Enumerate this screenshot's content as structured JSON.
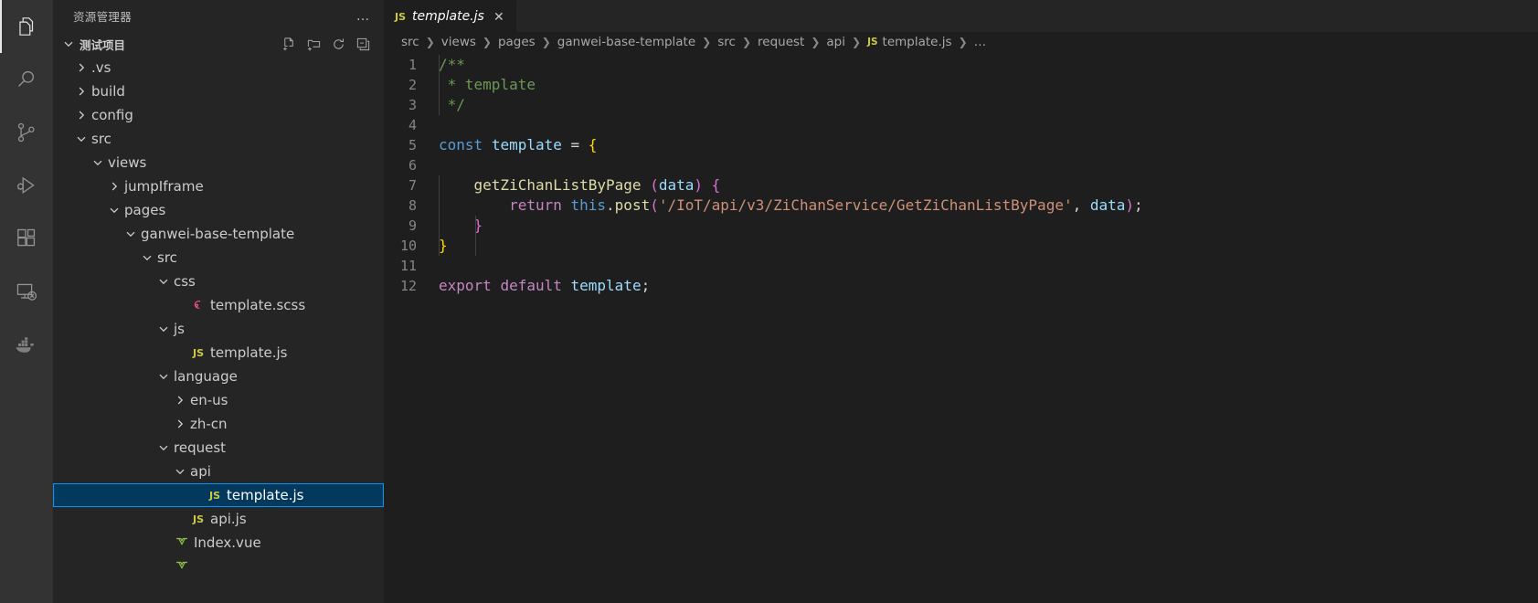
{
  "activity_bar": {
    "items": [
      {
        "name": "explorer",
        "icon": "files-icon",
        "active": true
      },
      {
        "name": "search",
        "icon": "search-icon",
        "active": false
      },
      {
        "name": "source-control",
        "icon": "source-control-icon",
        "active": false
      },
      {
        "name": "run-and-debug",
        "icon": "run-debug-icon",
        "active": false
      },
      {
        "name": "extensions",
        "icon": "extensions-icon",
        "active": false
      },
      {
        "name": "remote-explorer",
        "icon": "remote-explorer-icon",
        "active": false
      },
      {
        "name": "docker",
        "icon": "docker-icon",
        "active": false
      }
    ]
  },
  "sidebar": {
    "title": "资源管理器",
    "more_actions_label": "…",
    "section": {
      "name": "测试项目",
      "expanded": true,
      "actions": [
        {
          "name": "new-file",
          "icon": "new-file-icon"
        },
        {
          "name": "new-folder",
          "icon": "new-folder-icon"
        },
        {
          "name": "refresh",
          "icon": "refresh-icon"
        },
        {
          "name": "collapse-all",
          "icon": "collapse-all-icon"
        }
      ]
    },
    "tree": [
      {
        "label": ".vs",
        "depth": 1,
        "type": "folder",
        "state": "collapsed",
        "selected": false
      },
      {
        "label": "build",
        "depth": 1,
        "type": "folder",
        "state": "collapsed",
        "selected": false
      },
      {
        "label": "config",
        "depth": 1,
        "type": "folder",
        "state": "collapsed",
        "selected": false
      },
      {
        "label": "src",
        "depth": 1,
        "type": "folder",
        "state": "expanded",
        "selected": false
      },
      {
        "label": "views",
        "depth": 2,
        "type": "folder",
        "state": "expanded",
        "selected": false
      },
      {
        "label": "jumpIframe",
        "depth": 3,
        "type": "folder",
        "state": "collapsed",
        "selected": false
      },
      {
        "label": "pages",
        "depth": 3,
        "type": "folder",
        "state": "expanded",
        "selected": false
      },
      {
        "label": "ganwei-base-template",
        "depth": 4,
        "type": "folder",
        "state": "expanded",
        "selected": false
      },
      {
        "label": "src",
        "depth": 5,
        "type": "folder",
        "state": "expanded",
        "selected": false
      },
      {
        "label": "css",
        "depth": 6,
        "type": "folder",
        "state": "expanded",
        "selected": false
      },
      {
        "label": "template.scss",
        "depth": 7,
        "type": "file",
        "icon": "scss",
        "selected": false
      },
      {
        "label": "js",
        "depth": 6,
        "type": "folder",
        "state": "expanded",
        "selected": false
      },
      {
        "label": "template.js",
        "depth": 7,
        "type": "file",
        "icon": "js",
        "selected": false
      },
      {
        "label": "language",
        "depth": 6,
        "type": "folder",
        "state": "expanded",
        "selected": false
      },
      {
        "label": "en-us",
        "depth": 7,
        "type": "folder",
        "state": "collapsed",
        "selected": false
      },
      {
        "label": "zh-cn",
        "depth": 7,
        "type": "folder",
        "state": "collapsed",
        "selected": false
      },
      {
        "label": "request",
        "depth": 6,
        "type": "folder",
        "state": "expanded",
        "selected": false
      },
      {
        "label": "api",
        "depth": 7,
        "type": "folder",
        "state": "expanded",
        "selected": false
      },
      {
        "label": "template.js",
        "depth": 8,
        "type": "file",
        "icon": "js",
        "selected": true
      },
      {
        "label": "api.js",
        "depth": 7,
        "type": "file",
        "icon": "js",
        "selected": false
      },
      {
        "label": "Index.vue",
        "depth": 6,
        "type": "file",
        "icon": "vue",
        "selected": false
      },
      {
        "label": "",
        "depth": 6,
        "type": "file",
        "icon": "vue",
        "selected": false
      }
    ]
  },
  "editor": {
    "tabs": [
      {
        "label": "template.js",
        "icon": "js",
        "active": true,
        "preview": true,
        "close_label": "✕"
      }
    ],
    "breadcrumbs": [
      {
        "label": "src"
      },
      {
        "label": "views"
      },
      {
        "label": "pages"
      },
      {
        "label": "ganwei-base-template"
      },
      {
        "label": "src"
      },
      {
        "label": "request"
      },
      {
        "label": "api"
      },
      {
        "label": "template.js",
        "icon": "js"
      },
      {
        "label": "…"
      }
    ],
    "line_numbers": [
      1,
      2,
      3,
      4,
      5,
      6,
      7,
      8,
      9,
      10,
      11,
      12
    ],
    "code": [
      {
        "line": 1,
        "tokens": [
          {
            "t": "/**",
            "c": "t-comment"
          }
        ]
      },
      {
        "line": 2,
        "tokens": [
          {
            "t": " * template",
            "c": "t-comment"
          }
        ]
      },
      {
        "line": 3,
        "tokens": [
          {
            "t": " */",
            "c": "t-comment"
          }
        ]
      },
      {
        "line": 4,
        "tokens": []
      },
      {
        "line": 5,
        "tokens": [
          {
            "t": "const",
            "c": "t-keyword"
          },
          {
            "t": " ",
            "c": "t-plain"
          },
          {
            "t": "template",
            "c": "t-var"
          },
          {
            "t": " ",
            "c": "t-plain"
          },
          {
            "t": "=",
            "c": "t-plain"
          },
          {
            "t": " ",
            "c": "t-plain"
          },
          {
            "t": "{",
            "c": "t-br-y"
          }
        ]
      },
      {
        "line": 6,
        "tokens": []
      },
      {
        "line": 7,
        "tokens": [
          {
            "t": "    ",
            "c": "t-plain"
          },
          {
            "t": "getZiChanListByPage",
            "c": "t-func"
          },
          {
            "t": " ",
            "c": "t-plain"
          },
          {
            "t": "(",
            "c": "t-br-p"
          },
          {
            "t": "data",
            "c": "t-var"
          },
          {
            "t": ")",
            "c": "t-br-p"
          },
          {
            "t": " ",
            "c": "t-plain"
          },
          {
            "t": "{",
            "c": "t-br-p"
          }
        ]
      },
      {
        "line": 8,
        "tokens": [
          {
            "t": "        ",
            "c": "t-plain"
          },
          {
            "t": "return",
            "c": "t-kw2"
          },
          {
            "t": " ",
            "c": "t-plain"
          },
          {
            "t": "this",
            "c": "t-keyword"
          },
          {
            "t": ".",
            "c": "t-plain"
          },
          {
            "t": "post",
            "c": "t-func"
          },
          {
            "t": "(",
            "c": "t-br-p"
          },
          {
            "t": "'/IoT/api/v3/ZiChanService/GetZiChanListByPage'",
            "c": "t-string"
          },
          {
            "t": ",",
            "c": "t-plain"
          },
          {
            "t": " ",
            "c": "t-plain"
          },
          {
            "t": "data",
            "c": "t-var"
          },
          {
            "t": ")",
            "c": "t-br-p"
          },
          {
            "t": ";",
            "c": "t-plain"
          }
        ]
      },
      {
        "line": 9,
        "tokens": [
          {
            "t": "    ",
            "c": "t-plain"
          },
          {
            "t": "}",
            "c": "t-br-p"
          }
        ]
      },
      {
        "line": 10,
        "tokens": [
          {
            "t": "}",
            "c": "t-br-y"
          }
        ]
      },
      {
        "line": 11,
        "tokens": []
      },
      {
        "line": 12,
        "tokens": [
          {
            "t": "export",
            "c": "t-kw2"
          },
          {
            "t": " ",
            "c": "t-plain"
          },
          {
            "t": "default",
            "c": "t-kw2"
          },
          {
            "t": " ",
            "c": "t-plain"
          },
          {
            "t": "template",
            "c": "t-var"
          },
          {
            "t": ";",
            "c": "t-plain"
          }
        ]
      }
    ]
  },
  "colors": {
    "activity_bar_bg": "#333333",
    "sidebar_bg": "#252526",
    "editor_bg": "#1e1e1e",
    "selection_bg": "#04395e",
    "selection_border": "#0097fb",
    "line_number_fg": "#858585",
    "js_icon": "#cbcb41",
    "vue_icon": "#8dc149",
    "scss_icon": "#f55385"
  }
}
